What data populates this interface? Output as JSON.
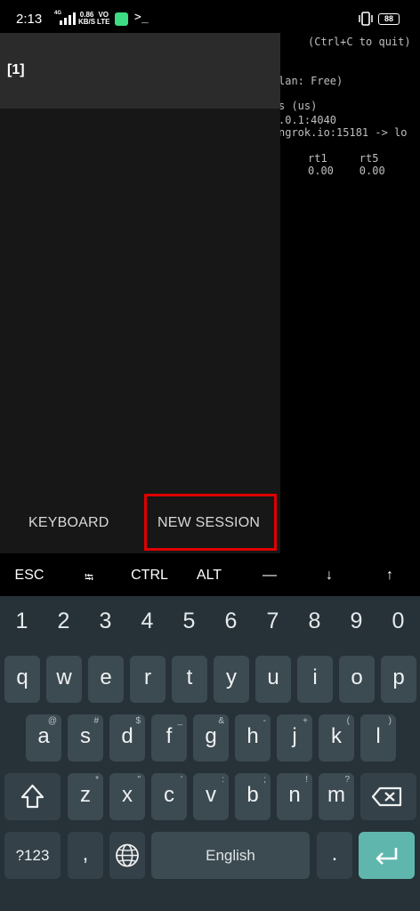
{
  "status": {
    "time": "2:13",
    "network_label": "4G",
    "speed_value": "0.86",
    "speed_unit": "KB/S",
    "volte_top": "VO",
    "volte_bottom": "LTE",
    "prompt_symbol": ">_",
    "battery": "88"
  },
  "terminal": {
    "lines": [
      "(Ctrl+C to quit)",
      "lan: Free)",
      "s (us)",
      ".0.1:4040",
      "ngrok.io:15181 -> lo",
      "rt1     rt5",
      "0.00    0.00"
    ]
  },
  "drawer": {
    "session_label": "[1]",
    "keyboard_button": "KEYBOARD",
    "new_session_button": "NEW SESSION"
  },
  "extra_keys": [
    "ESC",
    "⭾",
    "CTRL",
    "ALT",
    "—",
    "↓",
    "↑"
  ],
  "keyboard": {
    "numbers": [
      "1",
      "2",
      "3",
      "4",
      "5",
      "6",
      "7",
      "8",
      "9",
      "0"
    ],
    "row1": [
      {
        "key": "q",
        "hint": ""
      },
      {
        "key": "w",
        "hint": ""
      },
      {
        "key": "e",
        "hint": ""
      },
      {
        "key": "r",
        "hint": ""
      },
      {
        "key": "t",
        "hint": ""
      },
      {
        "key": "y",
        "hint": ""
      },
      {
        "key": "u",
        "hint": ""
      },
      {
        "key": "i",
        "hint": ""
      },
      {
        "key": "o",
        "hint": ""
      },
      {
        "key": "p",
        "hint": ""
      }
    ],
    "row2": [
      {
        "key": "a",
        "hint": "@"
      },
      {
        "key": "s",
        "hint": "#"
      },
      {
        "key": "d",
        "hint": "$"
      },
      {
        "key": "f",
        "hint": "_"
      },
      {
        "key": "g",
        "hint": "&"
      },
      {
        "key": "h",
        "hint": "-"
      },
      {
        "key": "j",
        "hint": "+"
      },
      {
        "key": "k",
        "hint": "("
      },
      {
        "key": "l",
        "hint": ")"
      }
    ],
    "row3": [
      {
        "key": "z",
        "hint": "*"
      },
      {
        "key": "x",
        "hint": "\""
      },
      {
        "key": "c",
        "hint": "'"
      },
      {
        "key": "v",
        "hint": ":"
      },
      {
        "key": "b",
        "hint": ";"
      },
      {
        "key": "n",
        "hint": "!"
      },
      {
        "key": "m",
        "hint": "?"
      }
    ],
    "symbols_label": "?123",
    "comma": ",",
    "space_label": "English",
    "period": "."
  }
}
